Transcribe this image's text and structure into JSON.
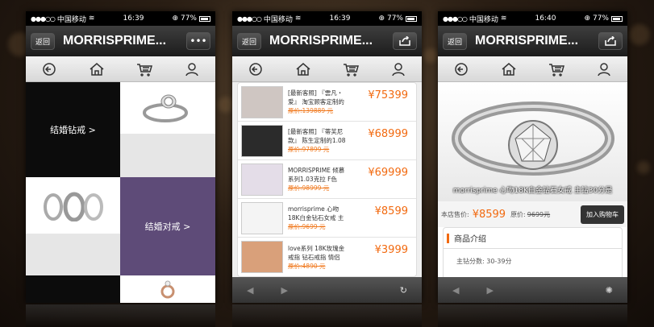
{
  "status": {
    "carrier": "中国移动",
    "battery": "77%"
  },
  "phones": [
    {
      "time": "16:39",
      "back_label": "返回",
      "title": "MORRISPRIME...",
      "right_button": "•••",
      "tiles": {
        "engagement": "结婚钻戒 >",
        "wedding": "结婚对戒 >"
      }
    },
    {
      "time": "16:39",
      "back_label": "返回",
      "title": "MORRISPRIME...",
      "products": [
        {
          "name": "[最新客照] 『雲凡・爱』 淘宝顾客定制的",
          "orig_label": "原价:",
          "orig": "139889 元",
          "price": "¥75399"
        },
        {
          "name": "[最新客照] 『蒂芙尼款』 陈生定制的1.08",
          "orig_label": "原价:",
          "orig": "97899 元",
          "price": "¥68999"
        },
        {
          "name": "MORRISPRIME 倾慕系列1.03克拉 F色",
          "orig_label": "原价:",
          "orig": "98999 元",
          "price": "¥69999"
        },
        {
          "name": "morrisprime 心吻18K白金钻石女戒 主",
          "orig_label": "原价:",
          "orig": "9699 元",
          "price": "¥8599"
        },
        {
          "name": "love系列 18K玫瑰金戒指 钻石戒指 情侣",
          "orig_label": "原价:",
          "orig": "4890 元",
          "price": "¥3999"
        }
      ]
    },
    {
      "time": "16:40",
      "back_label": "返回",
      "title": "MORRISPRIME...",
      "caption": "morrisprime 心吻18K白金钻石女戒 主钻30分是",
      "store_price_label": "本店售价:",
      "store_price": "¥8599",
      "orig_label": "原价:",
      "orig": "9699元",
      "cart_label": "加入购物车",
      "intro_title": "商品介绍",
      "intro_line": "主钻分数: 30-39分"
    }
  ]
}
